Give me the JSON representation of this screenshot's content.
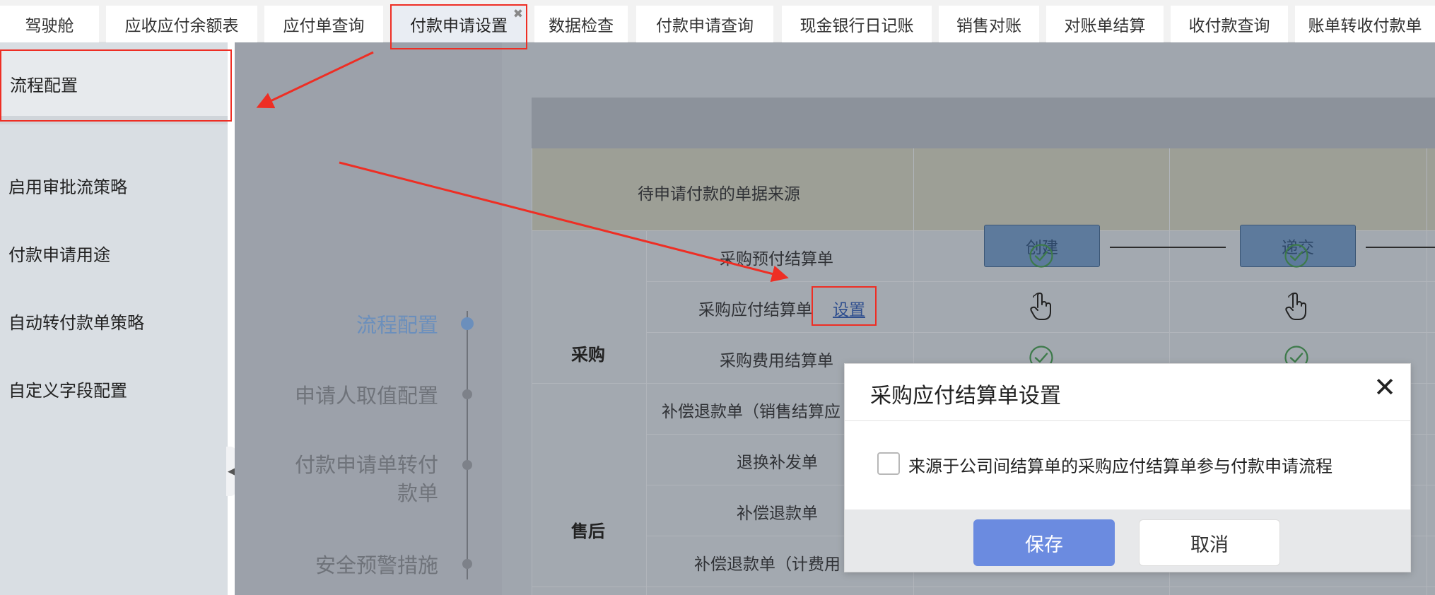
{
  "tabs": [
    {
      "label": "驾驶舱"
    },
    {
      "label": "应收应付余额表"
    },
    {
      "label": "应付单查询"
    },
    {
      "label": "付款申请设置",
      "close": "✖"
    },
    {
      "label": "数据检查"
    },
    {
      "label": "付款申请查询"
    },
    {
      "label": "现金银行日记账"
    },
    {
      "label": "销售对账"
    },
    {
      "label": "对账单结算"
    },
    {
      "label": "收付款查询"
    },
    {
      "label": "账单转收付款单"
    }
  ],
  "sidebar": {
    "items": [
      {
        "label": "流程配置"
      },
      {
        "label": "启用审批流策略"
      },
      {
        "label": "付款申请用途"
      },
      {
        "label": "自动转付款单策略"
      },
      {
        "label": "自定义字段配置"
      }
    ],
    "collapse_icon": "◀"
  },
  "steps": [
    {
      "label": "流程配置"
    },
    {
      "label": "申请人取值配置"
    },
    {
      "label": "付款申请单转付"
    },
    {
      "label": "款单"
    },
    {
      "label": "安全预警措施"
    }
  ],
  "grid": {
    "source_header": "待申请付款的单据来源",
    "flow_buttons": [
      "创建",
      "递交"
    ],
    "categories": [
      "采购",
      "售后"
    ],
    "rows": [
      "采购预付结算单",
      "采购应付结算单",
      "采购费用结算单",
      "补偿退款单（销售结算应",
      "退换补发单",
      "补偿退款单",
      "补偿退款单（计费用"
    ],
    "set_link": "设置",
    "icons": {
      "check": "check-circle-icon",
      "hand": "hand-pointer-icon"
    }
  },
  "modal": {
    "title": "采购应付结算单设置",
    "close": "✕",
    "checkbox_label": "来源于公司间结算单的采购应付结算单参与付款申请流程",
    "checkbox_checked": false,
    "save": "保存",
    "cancel": "取消"
  },
  "colors": {
    "annotation_red": "#ee2e24",
    "primary_button": "#6b8be0",
    "active_step": "#6b8fbc",
    "check_green": "#3d7a4a"
  }
}
